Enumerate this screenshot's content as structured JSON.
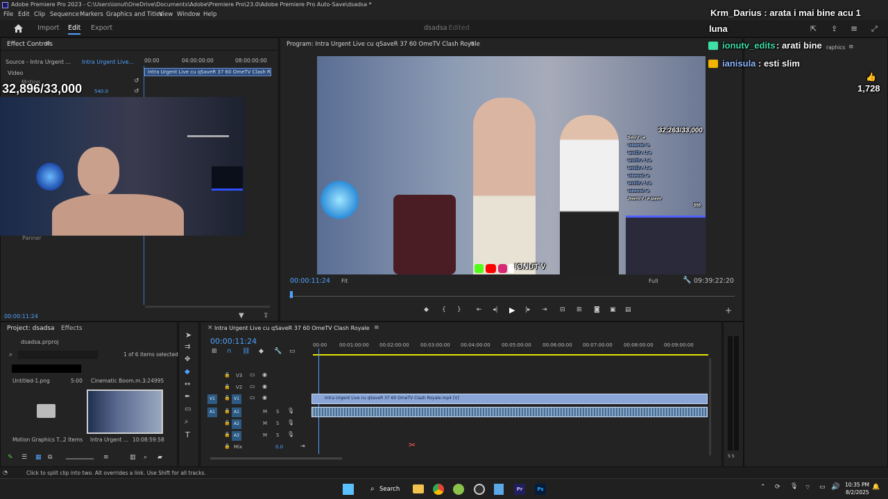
{
  "window": {
    "title": "Adobe Premiere Pro 2023 - C:\\Users\\ionut\\OneDrive\\Documents\\Adobe\\Premiere Pro\\23.0\\Adobe Premiere Pro Auto-Save\\dsadsa *"
  },
  "menu": [
    "File",
    "Edit",
    "Clip",
    "Sequence",
    "Markers",
    "Graphics and Titles",
    "View",
    "Window",
    "Help"
  ],
  "workspace": {
    "tabs": [
      "Import",
      "Edit",
      "Export"
    ],
    "active": "Edit",
    "project_name": "dsadsa",
    "project_state": "- Edited"
  },
  "effect_controls": {
    "title": "Effect Controls",
    "source": "Source - Intra Urgent ...",
    "clip": "Intra Urgent Live...",
    "video_label": "Video",
    "motion_label": "Motion",
    "panner_label": "Panner",
    "ruler": [
      "00:00",
      "04:00:00:00",
      "08:00:00:00"
    ],
    "clip_bar": "Intra Urgent Live cu qSaveR 37 60 OmeTV Clash Royale",
    "value_hint": "540.0",
    "timecode": "00:00:11:24"
  },
  "overlay": {
    "counter_left": "32,896/33,000",
    "chat_top": "Krm_Darius : arata i mai bine acu 1",
    "luna": "luna",
    "chat1_user": "ionutv_edits",
    "chat1_msg": " : arati bine",
    "chat2_user": "ianisula",
    "chat2_msg": " : esti slim",
    "likes": "1,728",
    "graphics_tab": "raphics",
    "counter_video": "32,263/33,000",
    "brand": "IONUT V",
    "mini_chat_lines": [
      "Seby V : w",
      "sekwered : w",
      "ianis19 v : L w",
      "ianis19 v : L w",
      "ianis19 v : L w",
      "sekwered : w",
      "ianis19 v : L w",
      "sekwered : w",
      "Jmarrio V : w qsaver"
    ],
    "mini_count": "555"
  },
  "program": {
    "title": "Program: Intra Urgent Live cu qSaveR 37 60 OmeTV Clash Royale",
    "timecode": "00:00:11:24",
    "fit": "Fit",
    "quality": "Full",
    "duration": "09:39:22:20",
    "playhead_fraction": 0.003
  },
  "project": {
    "tab": "Project: dsadsa",
    "effects_tab": "Effects",
    "file": "dsadsa.prproj",
    "selection": "1 of 6 items selected",
    "items": [
      {
        "name": "Untitled-1.png",
        "meta": "5:00"
      },
      {
        "name": "Cinematic Boom.m...",
        "meta": "3:24995"
      },
      {
        "name": "Motion Graphics T...",
        "meta": "2 Items"
      },
      {
        "name": "Intra Urgent ...",
        "meta": "10:08:59:58"
      }
    ]
  },
  "timeline": {
    "title": "Intra Urgent Live cu qSaveR 37 60 OmeTV Clash Royale",
    "timecode": "00:00:11:24",
    "ruler": [
      "00:00",
      "00:01:00:00",
      "00:02:00:00",
      "00:03:00:00",
      "00:04:00:00",
      "00:05:00:00",
      "00:06:00:00",
      "00:07:00:00",
      "00:08:00:00",
      "00:09:00:00"
    ],
    "video_tracks": [
      "V3",
      "V2",
      "V1"
    ],
    "audio_tracks": [
      "A1",
      "A2",
      "A3"
    ],
    "mix_label": "Mix",
    "mix_value": "0.0",
    "clip_name": "Intra Urgent Live cu qSaveR 37 60 OmeTV Clash Royale.mp4 [V]",
    "toggle_m": "M",
    "toggle_s": "S",
    "meter": "S S"
  },
  "status": {
    "text": "Click to split clip into two. Alt overrides a link. Use Shift for all tracks."
  },
  "taskbar": {
    "search": "Search",
    "time": "10:35 PM",
    "date": "8/2/2025"
  },
  "colors": {
    "accent": "#4ea3ff",
    "track_blue": "#2c5a82",
    "clip_blue": "#8aa6d8",
    "overlay_green": "#3ee0a8",
    "overlay_blue": "#8fb8ff"
  }
}
